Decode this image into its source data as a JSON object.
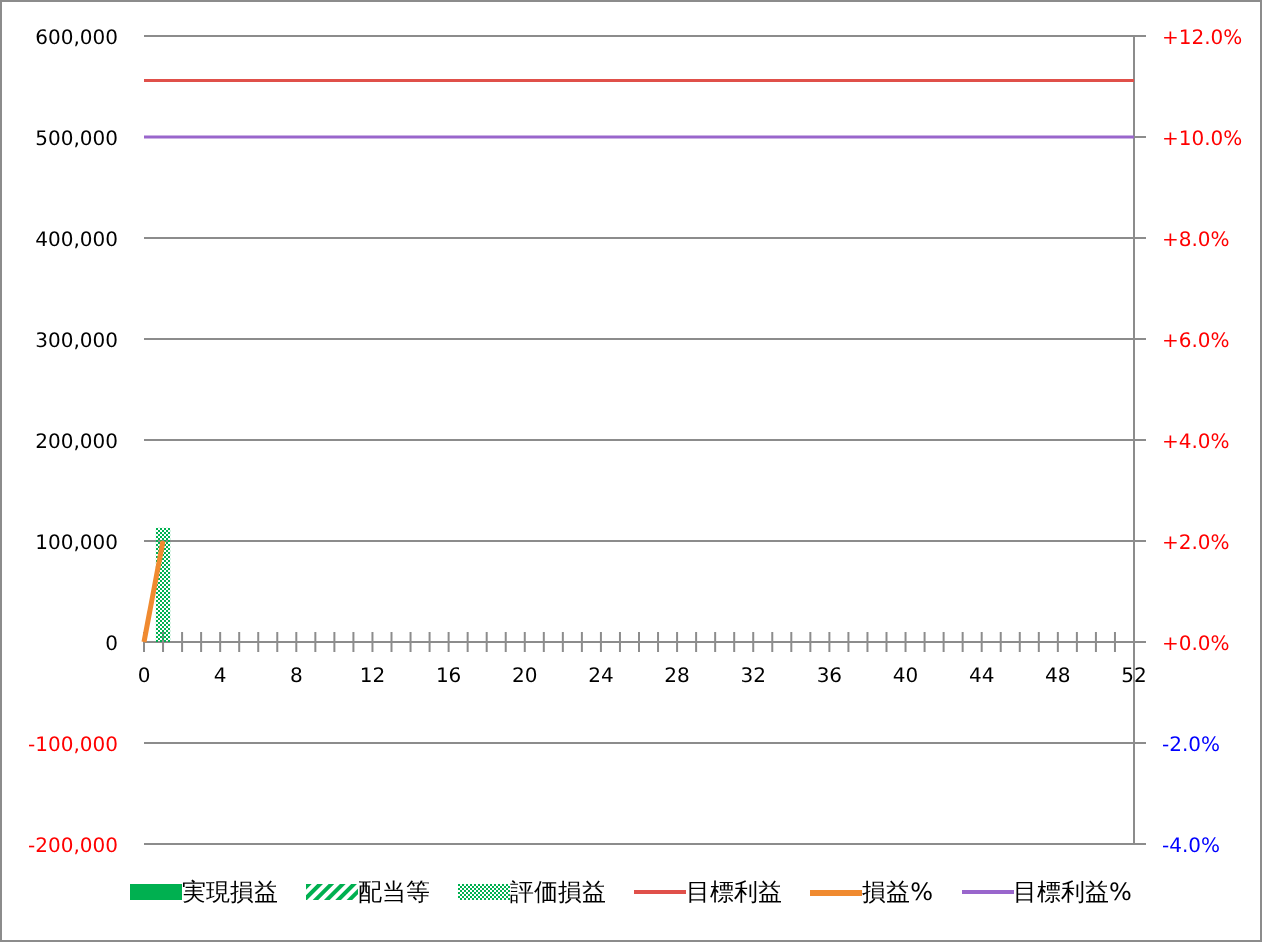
{
  "chart_data": {
    "type": "bar",
    "x": [
      0,
      1,
      2,
      3,
      4,
      5,
      6,
      7,
      8,
      9,
      10,
      11,
      12,
      13,
      14,
      15,
      16,
      17,
      18,
      19,
      20,
      21,
      22,
      23,
      24,
      25,
      26,
      27,
      28,
      29,
      30,
      31,
      32,
      33,
      34,
      35,
      36,
      37,
      38,
      39,
      40,
      41,
      42,
      43,
      44,
      45,
      46,
      47,
      48,
      49,
      50,
      51,
      52
    ],
    "xlim": [
      0,
      52
    ],
    "xticks": [
      0,
      4,
      8,
      12,
      16,
      20,
      24,
      28,
      32,
      36,
      40,
      44,
      48,
      52
    ],
    "ylim": [
      -200000,
      600000
    ],
    "grid": true,
    "yticks": [
      {
        "value": 600000,
        "label": "600,000"
      },
      {
        "value": 500000,
        "label": "500,000"
      },
      {
        "value": 400000,
        "label": "400,000"
      },
      {
        "value": 300000,
        "label": "300,000"
      },
      {
        "value": 200000,
        "label": "200,000"
      },
      {
        "value": 100000,
        "label": "100,000"
      },
      {
        "value": 0,
        "label": "0"
      },
      {
        "value": -100000,
        "label": "-100,000"
      },
      {
        "value": -200000,
        "label": "-200,000"
      }
    ],
    "y2lim": [
      -4,
      12
    ],
    "y2ticks": [
      {
        "value": 12,
        "label": "+12.0%"
      },
      {
        "value": 10,
        "label": "+10.0%"
      },
      {
        "value": 8,
        "label": "+8.0%"
      },
      {
        "value": 6,
        "label": "+6.0%"
      },
      {
        "value": 4,
        "label": "+4.0%"
      },
      {
        "value": 2,
        "label": "+2.0%"
      },
      {
        "value": 0,
        "label": "+0.0%"
      },
      {
        "value": -2,
        "label": "-2.0%"
      },
      {
        "value": -4,
        "label": "-4.0%"
      }
    ],
    "series": [
      {
        "name": "実現損益",
        "type": "bar",
        "color": "#00b050",
        "values": [
          null,
          null,
          null,
          null,
          null,
          null,
          null,
          null,
          null,
          null,
          null,
          null,
          null,
          null,
          null,
          null,
          null,
          null,
          null,
          null,
          null,
          null,
          null,
          null,
          null,
          null,
          null,
          null,
          null,
          null,
          null,
          null,
          null,
          null,
          null,
          null,
          null,
          null,
          null,
          null,
          null,
          null,
          null,
          null,
          null,
          null,
          null,
          null,
          null,
          null,
          null,
          null,
          null
        ]
      },
      {
        "name": "配当等",
        "type": "bar",
        "color": "#00b050",
        "values": [
          null,
          null,
          null,
          null,
          null,
          null,
          null,
          null,
          null,
          null,
          null,
          null,
          null,
          null,
          null,
          null,
          null,
          null,
          null,
          null,
          null,
          null,
          null,
          null,
          null,
          null,
          null,
          null,
          null,
          null,
          null,
          null,
          null,
          null,
          null,
          null,
          null,
          null,
          null,
          null,
          null,
          null,
          null,
          null,
          null,
          null,
          null,
          null,
          null,
          null,
          null,
          null,
          null
        ]
      },
      {
        "name": "評価損益",
        "type": "bar",
        "color": "#00b050",
        "values": [
          null,
          113000,
          null,
          null,
          null,
          null,
          null,
          null,
          null,
          null,
          null,
          null,
          null,
          null,
          null,
          null,
          null,
          null,
          null,
          null,
          null,
          null,
          null,
          null,
          null,
          null,
          null,
          null,
          null,
          null,
          null,
          null,
          null,
          null,
          null,
          null,
          null,
          null,
          null,
          null,
          null,
          null,
          null,
          null,
          null,
          null,
          null,
          null,
          null,
          null,
          null,
          null,
          null
        ]
      },
      {
        "name": "目標利益",
        "type": "line",
        "color": "#e0504a",
        "values": [
          556000,
          556000,
          556000,
          556000,
          556000,
          556000,
          556000,
          556000,
          556000,
          556000,
          556000,
          556000,
          556000,
          556000,
          556000,
          556000,
          556000,
          556000,
          556000,
          556000,
          556000,
          556000,
          556000,
          556000,
          556000,
          556000,
          556000,
          556000,
          556000,
          556000,
          556000,
          556000,
          556000,
          556000,
          556000,
          556000,
          556000,
          556000,
          556000,
          556000,
          556000,
          556000,
          556000,
          556000,
          556000,
          556000,
          556000,
          556000,
          556000,
          556000,
          556000,
          556000,
          556000
        ]
      },
      {
        "name": "損益%",
        "type": "line",
        "axis": "y2",
        "color": "#f08a30",
        "values": [
          0,
          2,
          null,
          null,
          null,
          null,
          null,
          null,
          null,
          null,
          null,
          null,
          null,
          null,
          null,
          null,
          null,
          null,
          null,
          null,
          null,
          null,
          null,
          null,
          null,
          null,
          null,
          null,
          null,
          null,
          null,
          null,
          null,
          null,
          null,
          null,
          null,
          null,
          null,
          null,
          null,
          null,
          null,
          null,
          null,
          null,
          null,
          null,
          null,
          null,
          null,
          null,
          null
        ]
      },
      {
        "name": "目標利益%",
        "type": "line",
        "axis": "y2",
        "color": "#9966cc",
        "values": [
          10,
          10,
          10,
          10,
          10,
          10,
          10,
          10,
          10,
          10,
          10,
          10,
          10,
          10,
          10,
          10,
          10,
          10,
          10,
          10,
          10,
          10,
          10,
          10,
          10,
          10,
          10,
          10,
          10,
          10,
          10,
          10,
          10,
          10,
          10,
          10,
          10,
          10,
          10,
          10,
          10,
          10,
          10,
          10,
          10,
          10,
          10,
          10,
          10,
          10,
          10,
          10,
          10
        ]
      }
    ]
  }
}
